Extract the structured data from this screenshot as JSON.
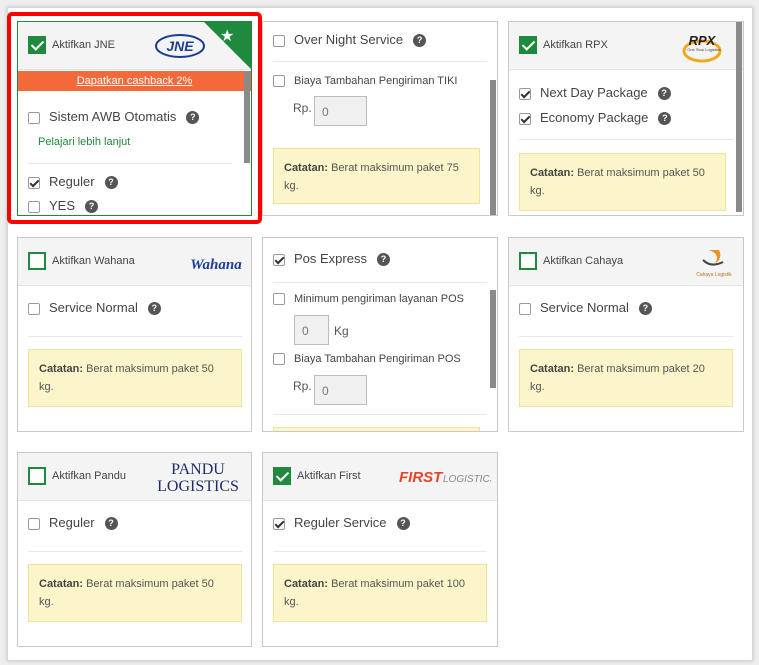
{
  "common": {
    "note_prefix": "Catatan:",
    "help": "?",
    "rp": "Rp.",
    "kg": "Kg"
  },
  "jne": {
    "title": "Aktifkan JNE",
    "logo": "JNE",
    "cashback": "Dapatkan cashback 2%",
    "awb": "Sistem AWB Otomatis",
    "learn": "Pelajari lebih lanjut",
    "services": [
      "Reguler",
      "YES"
    ]
  },
  "tiki": {
    "service": "Over Night Service",
    "surcharge_label": "Biaya Tambahan Pengiriman TIKI",
    "surcharge_value": "0",
    "note": "Berat maksimum paket 75 kg."
  },
  "rpx": {
    "title": "Aktifkan RPX",
    "logo": "RPX",
    "logo_tagline": "One Stop Logistics",
    "services": [
      "Next Day Package",
      "Economy Package"
    ],
    "note": "Berat maksimum paket 50 kg."
  },
  "wahana": {
    "title": "Aktifkan Wahana",
    "logo": "Wahana",
    "service": "Service Normal",
    "note": "Berat maksimum paket 50 kg."
  },
  "pos": {
    "service": "Pos Express",
    "min_label": "Minimum pengiriman layanan POS",
    "min_value": "0",
    "surcharge_label": "Biaya Tambahan Pengiriman POS",
    "surcharge_value": "0"
  },
  "cahaya": {
    "title": "Aktifkan Cahaya",
    "logo": "Cahaya Logistik",
    "service": "Service Normal",
    "note": "Berat maksimum paket 20 kg."
  },
  "pandu": {
    "title": "Aktifkan Pandu",
    "logo_line1": "PANDU",
    "logo_line2": "LOGISTICS",
    "service": "Reguler",
    "note": "Berat maksimum paket 50 kg."
  },
  "first": {
    "title": "Aktifkan First",
    "logo_bold": "FIRST",
    "logo_rest": "LOGISTICS",
    "service": "Reguler Service",
    "note": "Berat maksimum paket 100 kg."
  },
  "colors": {
    "green": "#1f8a3e",
    "orange": "#f4693a",
    "highlight": "#ff0000",
    "note_bg": "#fcf5c9"
  }
}
